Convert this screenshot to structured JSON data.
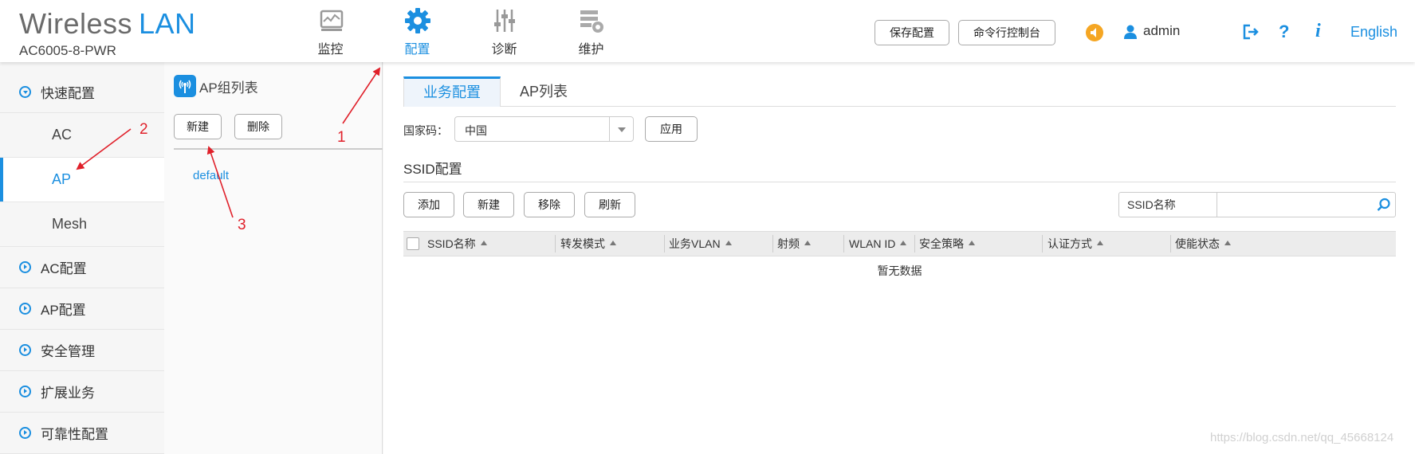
{
  "header": {
    "brand_word1": "Wireless",
    "brand_word2": "LAN",
    "model": "AC6005-8-PWR",
    "nav": [
      {
        "label": "监控",
        "icon": "monitor-icon"
      },
      {
        "label": "配置",
        "icon": "gear-icon",
        "active": true
      },
      {
        "label": "诊断",
        "icon": "sliders-icon"
      },
      {
        "label": "维护",
        "icon": "maintenance-icon"
      }
    ],
    "save_config": "保存配置",
    "cli_console": "命令行控制台",
    "user": "admin",
    "help": "?",
    "info": "i",
    "language": "English",
    "accent_color": "#1b8fe0",
    "alert_color": "#f5a623"
  },
  "sidebar": {
    "items": [
      {
        "label": "快速配置",
        "expanded": true
      },
      {
        "label": "AC"
      },
      {
        "label": "AP",
        "active": true
      },
      {
        "label": "Mesh"
      },
      {
        "label": "AC配置"
      },
      {
        "label": "AP配置"
      },
      {
        "label": "安全管理"
      },
      {
        "label": "扩展业务"
      },
      {
        "label": "可靠性配置"
      }
    ]
  },
  "group_panel": {
    "title": "AP组列表",
    "new_label": "新建",
    "delete_label": "删除",
    "groups": [
      "default"
    ]
  },
  "main": {
    "tabs": [
      {
        "label": "业务配置",
        "active": true
      },
      {
        "label": "AP列表"
      }
    ],
    "country_label": "国家码：",
    "country_value": "中国",
    "apply_label": "应用",
    "ssid_section_title": "SSID配置",
    "toolbar": {
      "add": "添加",
      "new": "新建",
      "remove": "移除",
      "refresh": "刷新"
    },
    "search": {
      "label": "SSID名称",
      "value": ""
    },
    "table": {
      "columns": [
        "SSID名称",
        "转发模式",
        "业务VLAN",
        "射频",
        "WLAN ID",
        "安全策略",
        "认证方式",
        "使能状态"
      ],
      "empty_text": "暂无数据"
    }
  },
  "annotations": [
    "1",
    "2",
    "3"
  ],
  "watermark": "https://blog.csdn.net/qq_45668124"
}
